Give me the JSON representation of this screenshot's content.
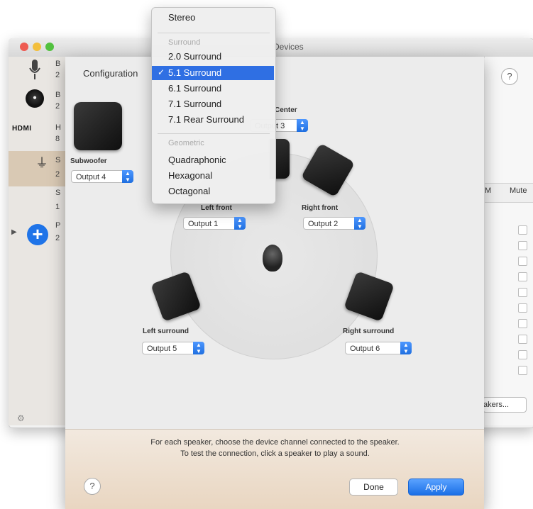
{
  "window": {
    "title": "Devices"
  },
  "sidebar": {
    "items": [
      {
        "label": "B",
        "sub": "2"
      },
      {
        "label": "B",
        "sub": "2"
      },
      {
        "label": "H",
        "sub": "8"
      },
      {
        "label": "S",
        "sub": "2"
      },
      {
        "label": "S",
        "sub": "1"
      },
      {
        "label": "P",
        "sub": "2"
      }
    ],
    "hdmi_label": "HDMI",
    "add_label": "+"
  },
  "back_panel": {
    "help_label": "?",
    "mute_label": "Mute",
    "m_label": "M",
    "speakers_button": "akers..."
  },
  "sheet": {
    "title": "Configuration",
    "center_label": "Center",
    "center_output": "Output 3",
    "subwoofer_label": "Subwoofer",
    "subwoofer_output": "Output 4",
    "left_front_label": "Left front",
    "left_front_output": "Output 1",
    "right_front_label": "Right front",
    "right_front_output": "Output 2",
    "left_surround_label": "Left surround",
    "left_surround_output": "Output 5",
    "right_surround_label": "Right surround",
    "right_surround_output": "Output 6",
    "instruction_line1": "For each speaker, choose the device channel connected to the speaker.",
    "instruction_line2": "To test the connection, click a speaker to play a sound.",
    "help_label": "?",
    "done_label": "Done",
    "apply_label": "Apply"
  },
  "menu": {
    "stereo": "Stereo",
    "surround_header": "Surround",
    "items_surround": [
      "2.0 Surround",
      "5.1 Surround",
      "6.1 Surround",
      "7.1 Surround",
      "7.1 Rear Surround"
    ],
    "selected": "5.1 Surround",
    "geometric_header": "Geometric",
    "items_geometric": [
      "Quadraphonic",
      "Hexagonal",
      "Octagonal"
    ]
  }
}
